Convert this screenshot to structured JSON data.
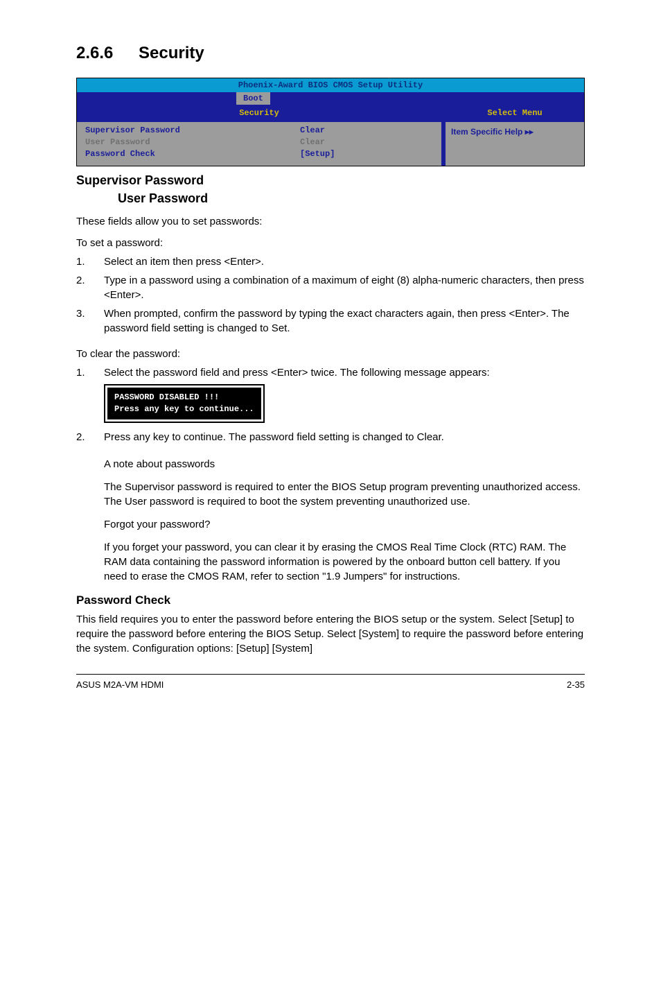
{
  "heading": {
    "num": "2.6.6",
    "title": "Security"
  },
  "bios": {
    "title": "Phoenix-Award BIOS CMOS Setup Utility",
    "tab": "Boot",
    "left_header": "Security",
    "right_header": "Select Menu",
    "rows": [
      {
        "label": "Supervisor Password",
        "value": "Clear",
        "active": true
      },
      {
        "label": "User Password",
        "value": "Clear",
        "active": false
      },
      {
        "label": "Password Check",
        "value": "[Setup]",
        "active": true
      }
    ],
    "help": "Item Specific Help ▸▸"
  },
  "sub1": {
    "title1": "Supervisor Password",
    "title2": "User Password"
  },
  "p1": "These fields allow you to set passwords:",
  "p2": "To set a password:",
  "steps_set": [
    "Select an item then press <Enter>.",
    "Type in a password using a combination of a maximum of eight (8) alpha-numeric characters, then press <Enter>.",
    "When prompted, confirm the password by typing the exact characters again, then press <Enter>. The password field setting is changed to Set."
  ],
  "p3": "To clear the password:",
  "steps_clear1": "Select the password field and press <Enter> twice. The following message appears:",
  "codebox": "PASSWORD DISABLED !!!\nPress any key to continue...",
  "steps_clear2": "Press any key to continue. The password field setting is changed to Clear.",
  "note": {
    "t1": "A note about passwords",
    "p1": "The Supervisor password is required to enter the BIOS Setup program preventing unauthorized access. The User password is required to boot the system preventing unauthorized use.",
    "t2": "Forgot your password?",
    "p2": "If you forget your password, you can clear it by erasing the CMOS Real Time Clock (RTC) RAM. The RAM data containing the password information is powered by the onboard button cell battery. If you need to erase the CMOS RAM, refer to section \"1.9 Jumpers\" for instructions."
  },
  "pwcheck": {
    "title": "Password Check",
    "body": "This field requires you to enter the password before entering the BIOS setup or the system. Select [Setup] to require the password before entering the BIOS Setup. Select [System] to require the password before entering the system. Configuration options: [Setup] [System]"
  },
  "footer": {
    "left": "ASUS M2A-VM HDMI",
    "right": "2-35"
  }
}
